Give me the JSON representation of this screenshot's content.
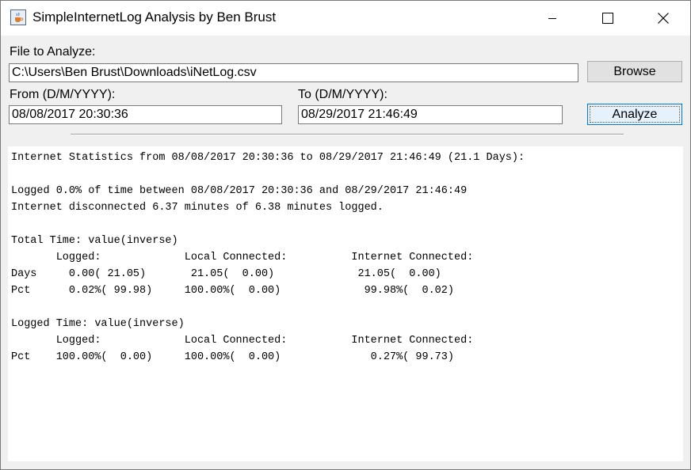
{
  "window": {
    "title": "SimpleInternetLog Analysis by Ben Brust",
    "icon": "java-cup-icon",
    "controls": [
      "minimize-icon",
      "maximize-icon",
      "close-icon"
    ]
  },
  "form": {
    "file_label": "File to Analyze:",
    "file_value": "C:\\Users\\Ben Brust\\Downloads\\iNetLog.csv",
    "browse_label": "Browse",
    "from_label": "From (D/M/YYYY):",
    "from_value": "08/08/2017 20:30:36",
    "to_label": "To (D/M/YYYY):",
    "to_value": "08/29/2017 21:46:49",
    "analyze_label": "Analyze"
  },
  "output": {
    "lines": [
      "Internet Statistics from 08/08/2017 20:30:36 to 08/29/2017 21:46:49 (21.1 Days):",
      "",
      "Logged 0.0% of time between 08/08/2017 20:30:36 and 08/29/2017 21:46:49",
      "Internet disconnected 6.37 minutes of 6.38 minutes logged.",
      "",
      "Total Time: value(inverse)",
      "       Logged:             Local Connected:          Internet Connected:",
      "Days     0.00( 21.05)       21.05(  0.00)             21.05(  0.00)",
      "Pct      0.02%( 99.98)     100.00%(  0.00)             99.98%(  0.02)",
      "",
      "Logged Time: value(inverse)",
      "       Logged:             Local Connected:          Internet Connected:",
      "Pct    100.00%(  0.00)     100.00%(  0.00)              0.27%( 99.73)"
    ]
  },
  "colors": {
    "window_bg": "#f0f0f0",
    "focus_border": "#0078d7",
    "button_bg": "#e1e1e1"
  }
}
